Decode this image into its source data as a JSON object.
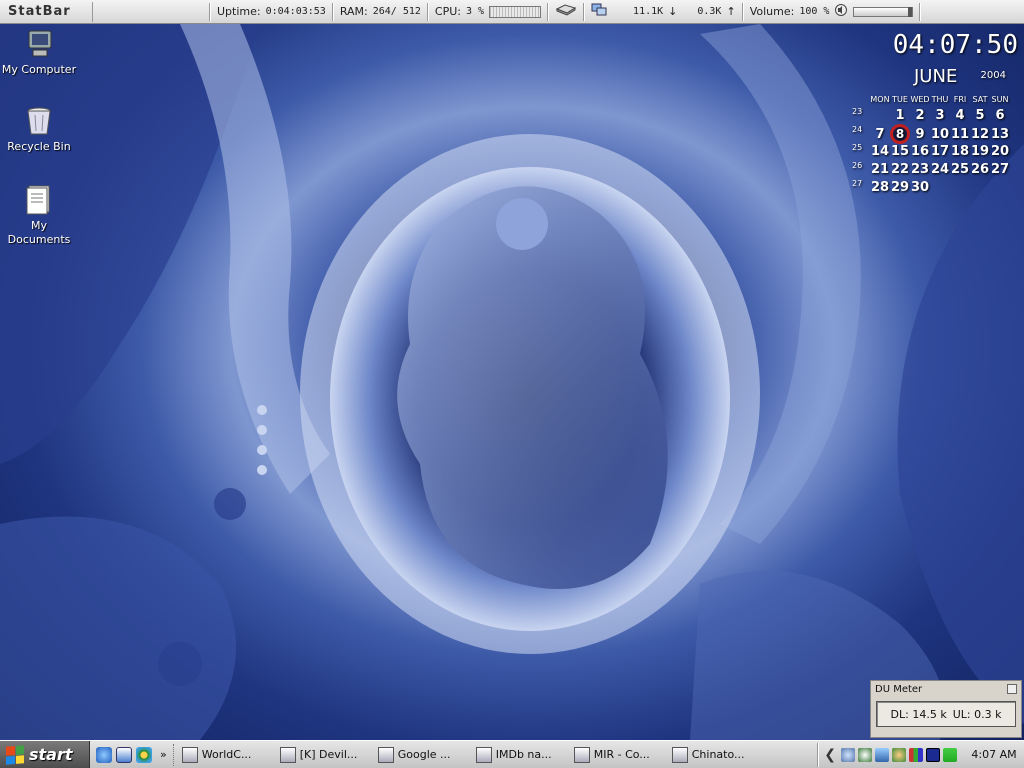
{
  "statbar": {
    "logo": "StatBar",
    "uptime_label": "Uptime:",
    "uptime_value": "0:04:03:53",
    "ram_label": "RAM:",
    "ram_value": "264/ 512",
    "cpu_label": "CPU:",
    "cpu_value": "3 %",
    "net_down": "11.1K",
    "net_up": "0.3K",
    "volume_label": "Volume:",
    "volume_value": "100 %",
    "volume_level": 1.0
  },
  "desktop_icons": [
    {
      "label": "My Computer"
    },
    {
      "label": "Recycle Bin"
    },
    {
      "label": "My Documents"
    }
  ],
  "clock": {
    "time": "04:07:50"
  },
  "calendar": {
    "month": "JUNE",
    "year": "2004",
    "dow": [
      "MON",
      "TUE",
      "WED",
      "THU",
      "FRI",
      "SAT",
      "SUN"
    ],
    "today": "8",
    "weeks": [
      {
        "week": "23",
        "days": [
          "",
          "1",
          "2",
          "3",
          "4",
          "5",
          "6"
        ]
      },
      {
        "week": "24",
        "days": [
          "7",
          "8",
          "9",
          "10",
          "11",
          "12",
          "13"
        ]
      },
      {
        "week": "25",
        "days": [
          "14",
          "15",
          "16",
          "17",
          "18",
          "19",
          "20"
        ]
      },
      {
        "week": "26",
        "days": [
          "21",
          "22",
          "23",
          "24",
          "25",
          "26",
          "27"
        ]
      },
      {
        "week": "27",
        "days": [
          "28",
          "29",
          "30",
          "",
          "",
          "",
          ""
        ]
      }
    ]
  },
  "du_meter": {
    "title": "DU Meter",
    "dl": "DL: 14.5 k",
    "ul": "UL: 0.3 k"
  },
  "taskbar": {
    "start_label": "start",
    "quick_launch_more": "»",
    "tasks": [
      {
        "label": "WorldC..."
      },
      {
        "label": "[K] Devil..."
      },
      {
        "label": "Google ..."
      },
      {
        "label": "IMDb na..."
      },
      {
        "label": "MIR - Co..."
      },
      {
        "label": "Chinato..."
      }
    ],
    "clock": "4:07 AM"
  },
  "colors": {
    "today_ring": "#c02020",
    "statbar_bg": "#e0e0e0",
    "wallpaper_blue": "#3d5aa8"
  }
}
